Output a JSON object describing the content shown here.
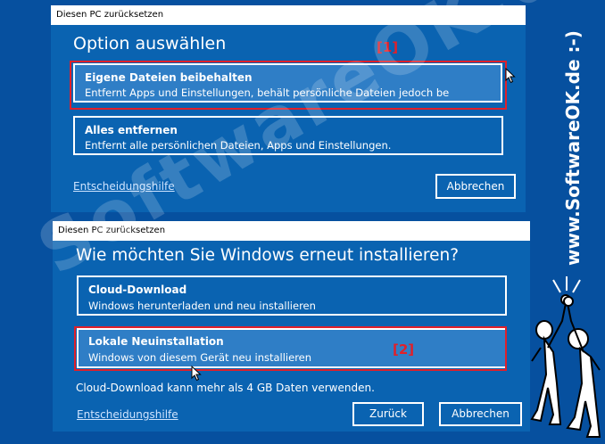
{
  "dialog1": {
    "title": "Diesen PC zurücksetzen",
    "heading": "Option auswählen",
    "options": [
      {
        "title": "Eigene Dateien beibehalten",
        "subtitle": "Entfernt Apps und Einstellungen, behält persönliche Dateien jedoch be"
      },
      {
        "title": "Alles entfernen",
        "subtitle": "Entfernt alle persönlichen Dateien, Apps und Einstellungen."
      }
    ],
    "help_link": "Entscheidungshilfe",
    "cancel_label": "Abbrechen",
    "marker": "[1]"
  },
  "dialog2": {
    "title": "Diesen PC zurücksetzen",
    "heading": "Wie möchten Sie Windows erneut installieren?",
    "options": [
      {
        "title": "Cloud-Download",
        "subtitle": "Windows herunterladen und neu installieren"
      },
      {
        "title": "Lokale Neuinstallation",
        "subtitle": "Windows von diesem Gerät neu installieren"
      }
    ],
    "note": "Cloud-Download kann mehr als 4 GB Daten verwenden.",
    "help_link": "Entscheidungshilfe",
    "back_label": "Zurück",
    "cancel_label": "Abbrechen",
    "marker": "[2]"
  },
  "branding": {
    "side_text": "www.SoftwareOK.de :-)",
    "watermark_text": "SoftwareOK.de"
  },
  "colors": {
    "dialog_bg": "#0a63b1",
    "outer_bg": "#06509f",
    "highlight": "#e0202a"
  }
}
